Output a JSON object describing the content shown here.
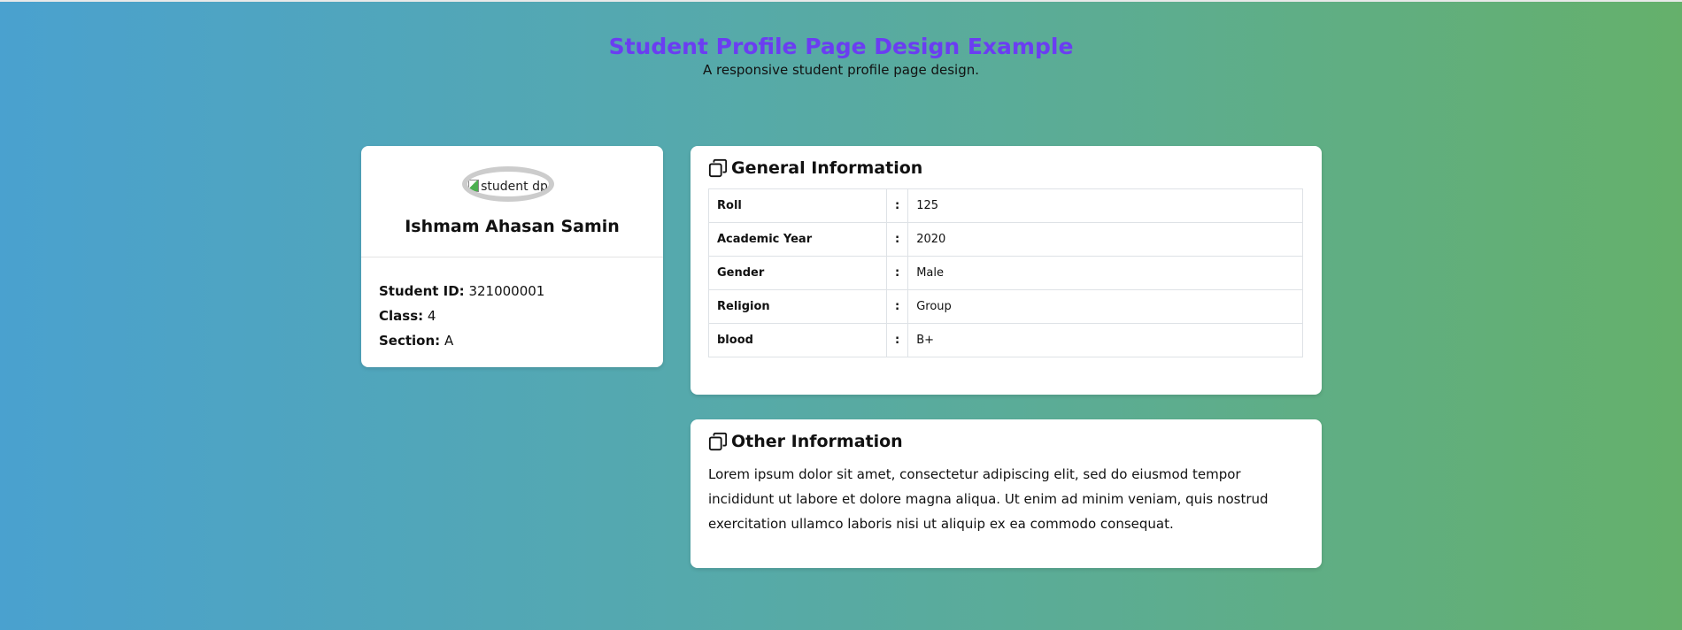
{
  "header": {
    "title": "Student Profile Page Design Example",
    "subtitle": "A responsive student profile page design."
  },
  "profile": {
    "avatar_alt": "student dp",
    "name": "Ishmam Ahasan Samin",
    "fields": [
      {
        "label": "Student ID:",
        "value": "321000001"
      },
      {
        "label": "Class:",
        "value": "4"
      },
      {
        "label": "Section:",
        "value": "A"
      }
    ]
  },
  "general": {
    "title": "General Information",
    "icon": "copy-icon",
    "separator": ":",
    "rows": [
      {
        "key": "Roll",
        "value": "125"
      },
      {
        "key": "Academic Year",
        "value": "2020"
      },
      {
        "key": "Gender",
        "value": "Male"
      },
      {
        "key": "Religion",
        "value": "Group"
      },
      {
        "key": "blood",
        "value": "B+"
      }
    ]
  },
  "other": {
    "title": "Other Information",
    "icon": "copy-icon",
    "text": "Lorem ipsum dolor sit amet, consectetur adipiscing elit, sed do eiusmod tempor incididunt ut labore et dolore magna aliqua. Ut enim ad minim veniam, quis nostrud exercitation ullamco laboris nisi ut aliquip ex ea commodo consequat."
  },
  "colors": {
    "title": "#6b3df2",
    "gradient_left": "#4aa1cf",
    "gradient_right": "#65b06b",
    "card": "#ffffff"
  }
}
